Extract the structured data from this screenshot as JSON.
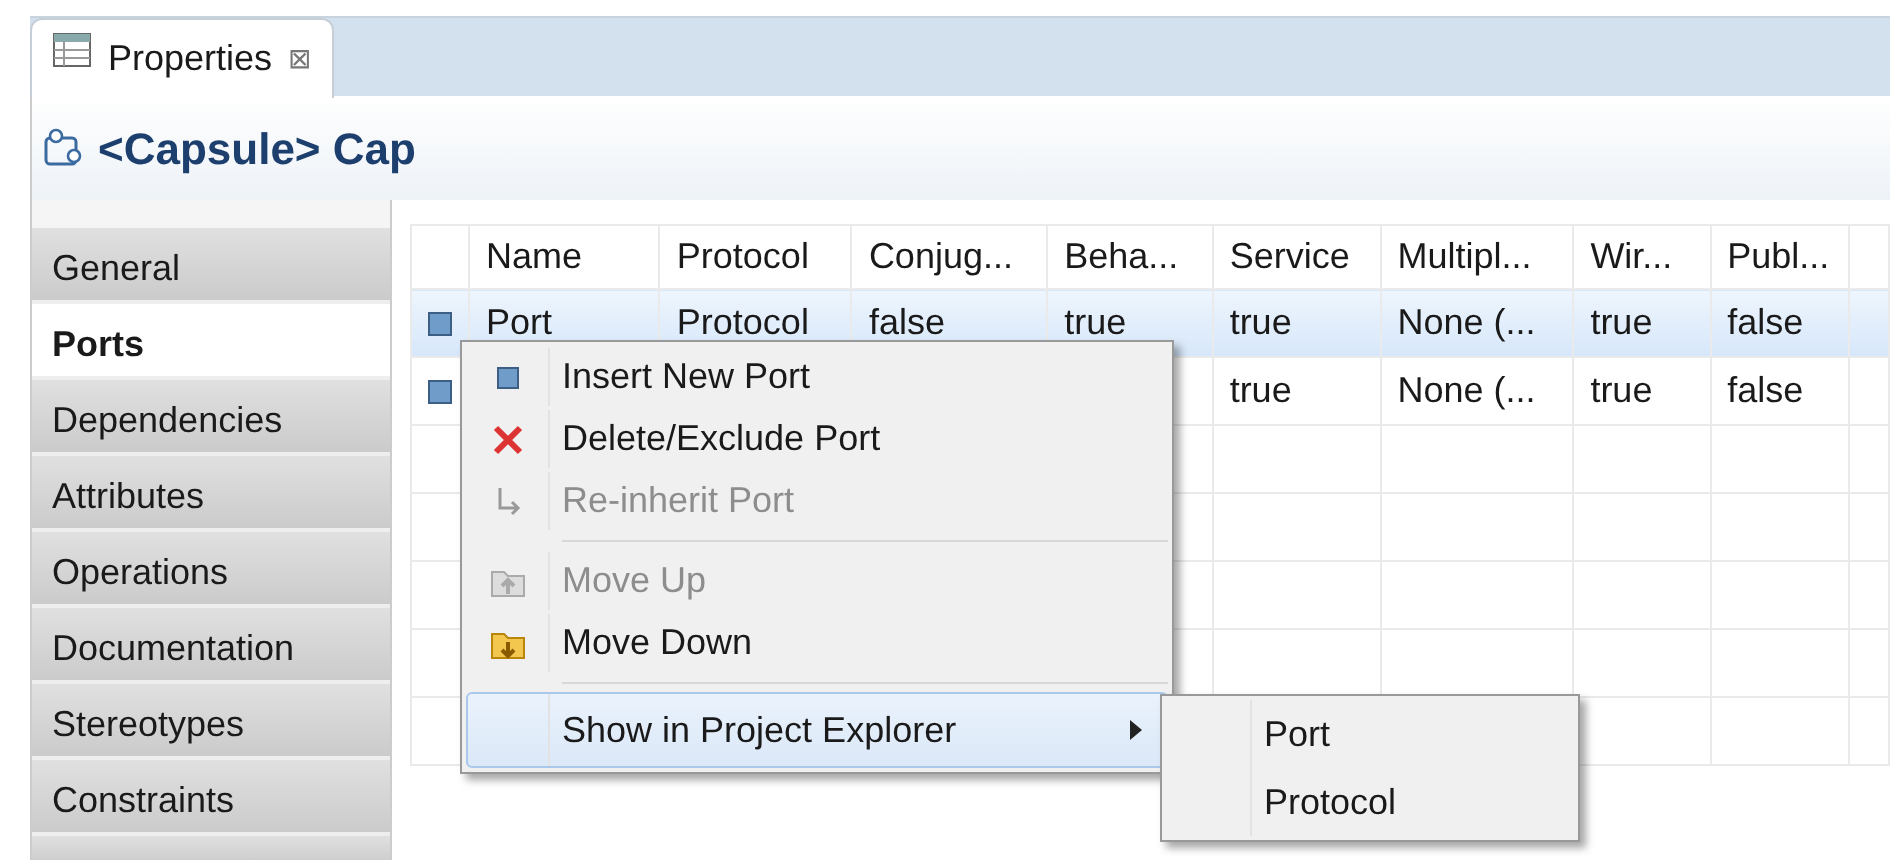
{
  "view_tab": {
    "label": "Properties",
    "close": "⊠",
    "selected": true
  },
  "header": {
    "title": "<Capsule> Cap"
  },
  "sidebar": {
    "items": [
      {
        "label": "General",
        "selected": false
      },
      {
        "label": "Ports",
        "selected": true
      },
      {
        "label": "Dependencies",
        "selected": false
      },
      {
        "label": "Attributes",
        "selected": false
      },
      {
        "label": "Operations",
        "selected": false
      },
      {
        "label": "Documentation",
        "selected": false
      },
      {
        "label": "Stereotypes",
        "selected": false
      },
      {
        "label": "Constraints",
        "selected": false
      }
    ]
  },
  "table": {
    "columns": [
      "Name",
      "Protocol",
      "Conjug...",
      "Beha...",
      "Service",
      "Multipl...",
      "Wir...",
      "Publ..."
    ],
    "rows": [
      {
        "selected": true,
        "cells": [
          "Port",
          "Protocol",
          "false",
          "true",
          "true",
          "None (...",
          "true",
          "false"
        ]
      },
      {
        "selected": false,
        "cells": [
          null,
          null,
          null,
          null,
          "true",
          "None (...",
          "true",
          "false"
        ]
      }
    ]
  },
  "context_menu": {
    "items": [
      {
        "kind": "item",
        "label": "Insert New Port",
        "disabled": false,
        "selected": false,
        "submenu": false
      },
      {
        "kind": "item",
        "label": "Delete/Exclude Port",
        "disabled": false,
        "selected": false,
        "submenu": false
      },
      {
        "kind": "item",
        "label": "Re-inherit Port",
        "disabled": true,
        "selected": false,
        "submenu": false
      },
      {
        "kind": "separator"
      },
      {
        "kind": "item",
        "label": "Move Up",
        "disabled": true,
        "selected": false,
        "submenu": false
      },
      {
        "kind": "item",
        "label": "Move Down",
        "disabled": false,
        "selected": false,
        "submenu": false
      },
      {
        "kind": "separator"
      },
      {
        "kind": "item",
        "label": "Show in Project Explorer",
        "disabled": false,
        "selected": true,
        "submenu": true
      }
    ]
  },
  "submenu": {
    "items": [
      "Port",
      "Protocol"
    ]
  }
}
